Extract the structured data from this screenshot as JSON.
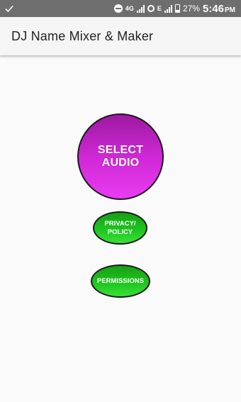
{
  "status_bar": {
    "network_label_1": "4G",
    "network_label_2": "E",
    "battery": "27%",
    "time": "5:46",
    "ampm": "PM"
  },
  "app_bar": {
    "title": "DJ Name Mixer & Maker"
  },
  "buttons": {
    "select_audio": "SELECT AUDIO",
    "privacy_line1": "PRIVACY/",
    "privacy_line2": "POLICY",
    "permissions": "PERMISSIONS"
  },
  "colors": {
    "status_bar": "#6e6e6e",
    "app_bar": "#f5f5f5",
    "background": "#fafafa",
    "select_audio": "#cf28d6",
    "green_button": "#1fc81f"
  },
  "icons": [
    "check-icon",
    "dnd-icon",
    "signal-icon",
    "vpn-icon",
    "battery-icon"
  ]
}
